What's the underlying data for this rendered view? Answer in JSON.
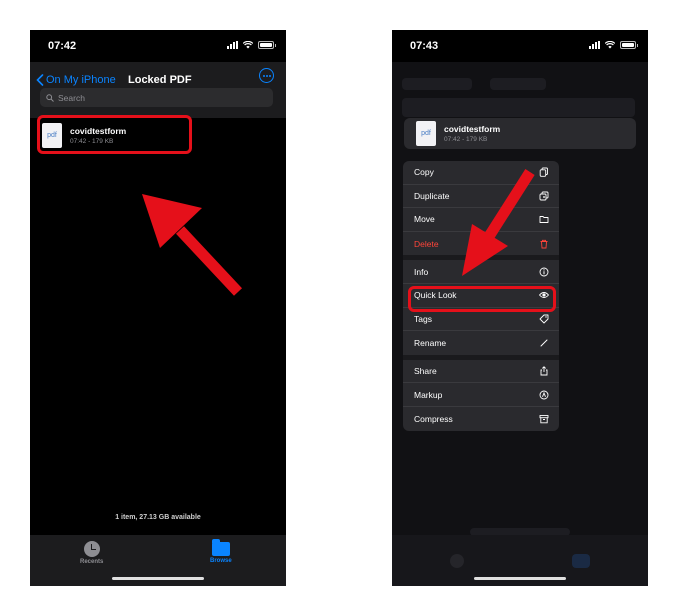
{
  "left": {
    "status": {
      "time": "07:42"
    },
    "nav": {
      "back_label": "On My iPhone",
      "title": "Locked PDF"
    },
    "search": {
      "placeholder": "Search"
    },
    "file": {
      "thumb": "pdf",
      "name": "covidtestform",
      "meta": "07:42 - 179 KB"
    },
    "footer": {
      "summary": "1 item, 27.13 GB available"
    },
    "tabs": [
      {
        "label": "Recents",
        "icon": "clock-icon"
      },
      {
        "label": "Browse",
        "icon": "folder-icon"
      }
    ]
  },
  "right": {
    "status": {
      "time": "07:43"
    },
    "file": {
      "thumb": "pdf",
      "name": "covidtestform",
      "meta": "07:42 - 179 KB"
    },
    "menu": [
      {
        "label": "Copy",
        "icon": "copy-icon"
      },
      {
        "label": "Duplicate",
        "icon": "duplicate-icon"
      },
      {
        "label": "Move",
        "icon": "folder-icon"
      },
      {
        "label": "Delete",
        "icon": "trash-icon"
      },
      {
        "label": "Info",
        "icon": "info-icon"
      },
      {
        "label": "Quick Look",
        "icon": "eye-icon"
      },
      {
        "label": "Tags",
        "icon": "tag-icon"
      },
      {
        "label": "Rename",
        "icon": "pencil-icon"
      },
      {
        "label": "Share",
        "icon": "share-icon"
      },
      {
        "label": "Markup",
        "icon": "markup-icon"
      },
      {
        "label": "Compress",
        "icon": "archive-icon"
      }
    ]
  },
  "colors": {
    "accent": "#0a84ff",
    "danger": "#ff453a",
    "annotation": "#e5101a",
    "background": "#000000"
  }
}
